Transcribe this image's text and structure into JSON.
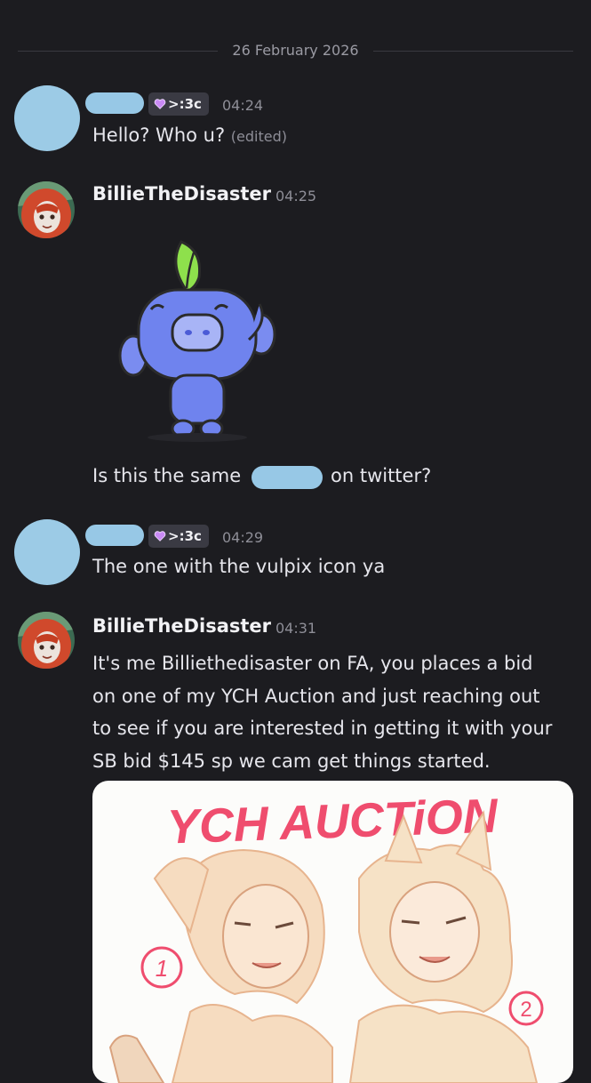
{
  "date_divider": "26 February 2026",
  "messages": [
    {
      "tag_label": ">:3c",
      "time": "04:24",
      "text": "Hello? Who u?",
      "edited": "(edited)"
    },
    {
      "username": "BillieTheDisaster",
      "time": "04:25",
      "text_before": "Is this the same",
      "text_after": "on twitter?"
    },
    {
      "tag_label": ">:3c",
      "time": "04:29",
      "text": "The one with the vulpix icon ya"
    },
    {
      "username": "BillieTheDisaster",
      "time": "04:31",
      "lines": [
        "It's me Billiethedisaster on FA, you places a bid",
        "on one of my YCH Auction and just reaching out",
        "to see if you are interested in getting it with your",
        "SB bid $145 sp we cam get things started."
      ],
      "attachment_title": "YCH AUCTiON",
      "attachment_marks": [
        "1",
        "2"
      ]
    }
  ],
  "icons": {
    "tag_heart": "purple-heart-icon",
    "sticker": "discord-wumpus-leaf-sticker",
    "avatar": "red-haired-character-avatar"
  },
  "colors": {
    "background": "#1c1c20",
    "redaction": "#97c8e6",
    "attachment_title": "#ef4d6e"
  }
}
